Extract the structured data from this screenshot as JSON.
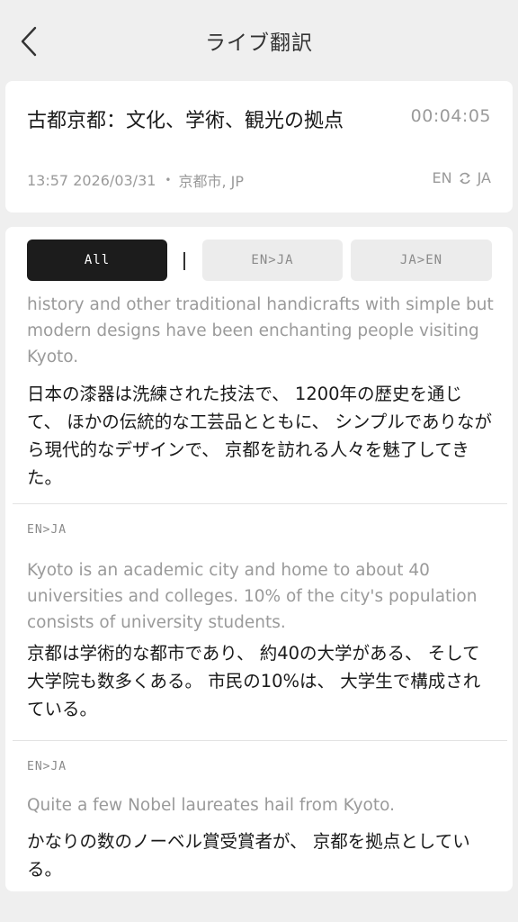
{
  "header": {
    "title": "ライブ翻訳",
    "back_icon": "chevron-left-icon"
  },
  "session": {
    "title": "古都京都：文化、学術、観光の拠点",
    "duration": "00:04:05",
    "time": "13:57",
    "date": "2026/03/31",
    "separator": "•",
    "location": "京都市, JP",
    "lang_from": "EN",
    "lang_to": "JA",
    "swap_icon": "swap-arrows-icon"
  },
  "filters": {
    "all": "All",
    "en_ja": "EN>JA",
    "ja_en": "JA>EN",
    "selected": "All"
  },
  "segments": [
    {
      "tag": "",
      "source": "history and other traditional handicrafts with simple but modern designs have been enchanting people visiting Kyoto.",
      "target": "日本の漆器は洗練された技法で、 1200年の歴史を通じて、 ほかの伝統的な工芸品とともに、 シンプルでありながら現代的なデザインで、 京都を訪れる人々を魅了してきた。"
    },
    {
      "tag": "EN>JA",
      "source": "Kyoto is an academic city and home to about 40 universities and colleges. 10% of the city's population consists of university students.",
      "target": "京都は学術的な都市であり、 約40の大学がある、 そして大学院も数多くある。 市民の10%は、 大学生で構成されている。"
    },
    {
      "tag": "EN>JA",
      "source": "Quite a few Nobel laureates hail from Kyoto.",
      "target": "かなりの数のノーベル賞受賞者が、 京都を拠点としている。"
    }
  ]
}
